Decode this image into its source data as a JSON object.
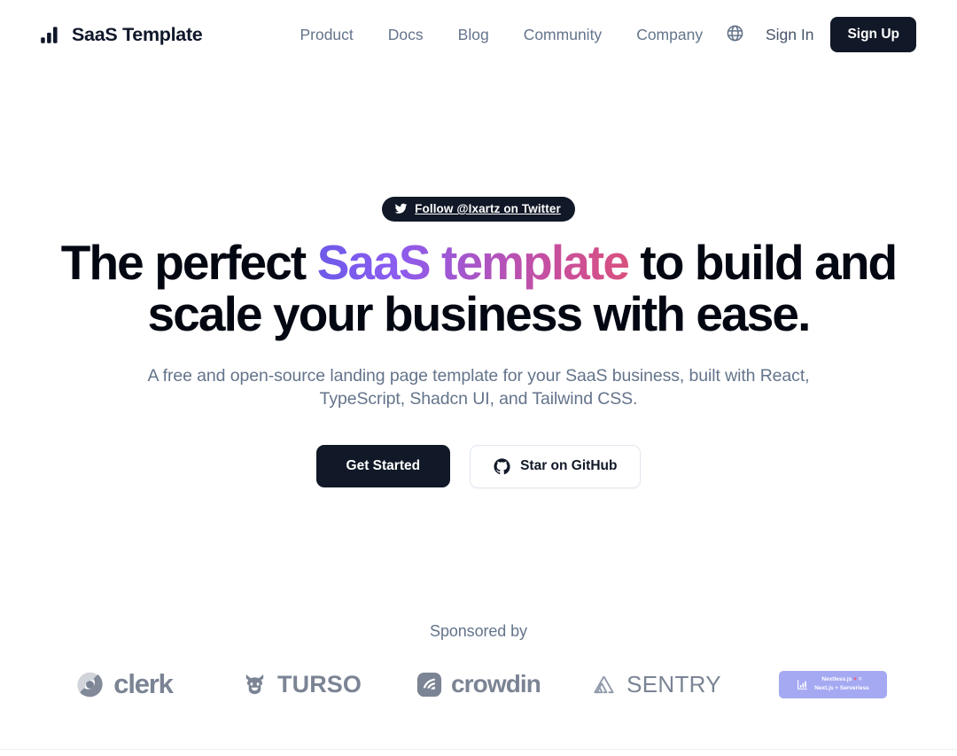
{
  "header": {
    "brand": {
      "icon": "bar-chart-icon",
      "name": "SaaS Template"
    },
    "nav": [
      {
        "label": "Product"
      },
      {
        "label": "Docs"
      },
      {
        "label": "Blog"
      },
      {
        "label": "Community"
      },
      {
        "label": "Company"
      }
    ],
    "locale_icon": "globe-icon",
    "sign_in_label": "Sign In",
    "sign_up_label": "Sign Up"
  },
  "hero": {
    "badge": {
      "icon": "twitter-icon",
      "label": "Follow @Ixartz on Twitter"
    },
    "headline": {
      "before": "The perfect ",
      "gradient": "SaaS template",
      "after": " to build and scale your business with ease."
    },
    "subtitle": "A free and open-source landing page template for your SaaS business, built with React, TypeScript, Shadcn UI, and Tailwind CSS.",
    "primary_cta": "Get Started",
    "secondary_cta": {
      "icon": "github-icon",
      "label": "Star on GitHub"
    }
  },
  "sponsors": {
    "title": "Sponsored by",
    "items": [
      {
        "name": "Clerk",
        "label": "clerk",
        "icon": "clerk-logo-icon"
      },
      {
        "name": "Turso",
        "label": "TURSO",
        "icon": "turso-bull-icon"
      },
      {
        "name": "Crowdin",
        "label": "crowdin",
        "icon": "crowdin-logo-icon"
      },
      {
        "name": "Sentry",
        "label": "SENTRY",
        "icon": "sentry-logo-icon"
      }
    ],
    "nextless": {
      "icon": "bar-chart-icon",
      "line1_before": "Nextless.js ",
      "line1_heart": "♥",
      "line1_after": " =",
      "line2": "Next.js + Serverless"
    }
  },
  "colors": {
    "dark": "#111827",
    "muted": "#64748b",
    "gradient_start": "#6d5ae8",
    "gradient_mid": "#a855c8",
    "gradient_end": "#d9507e",
    "nextless_bg": "#a5a9f2",
    "sponsor_grey": "#7b8494"
  }
}
